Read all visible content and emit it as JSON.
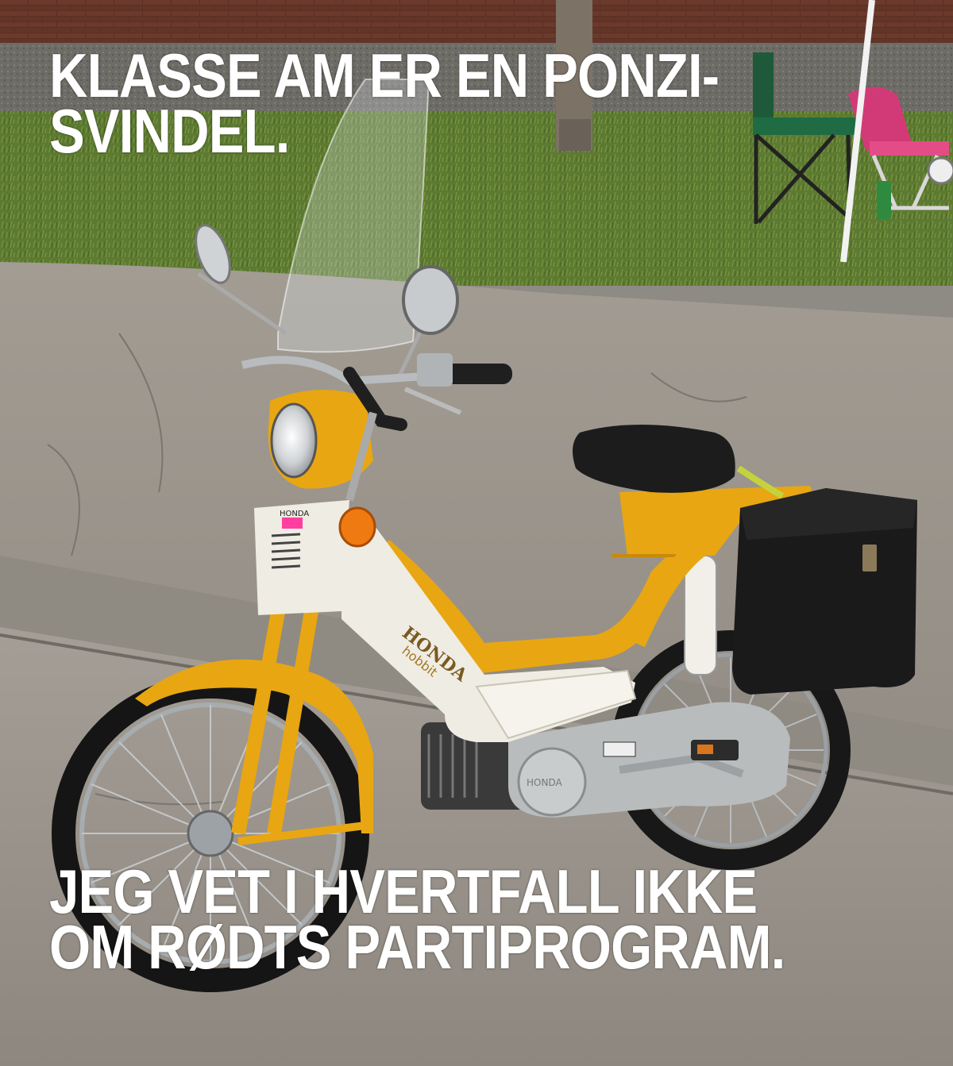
{
  "meme": {
    "top_text_lines": [
      "KLASSE AM ER EN PONZI-",
      "SVINDEL."
    ],
    "bottom_text_lines": [
      "JEG VET I HVERTFALL IKKE",
      "OM RØDTS PARTIPROGRAM."
    ]
  },
  "moped": {
    "brand_tank": "HONDA",
    "model_tank": "hobbit",
    "brand_front": "HONDA",
    "brand_engine": "HONDA"
  },
  "colors": {
    "frame_yellow": "#e8a612",
    "body_white": "#efece4",
    "seat_black": "#1c1c1c",
    "caption_text": "#ffffff",
    "pavement": "#9a948c",
    "grass": "#5d7a32",
    "brick": "#5a2e24"
  }
}
